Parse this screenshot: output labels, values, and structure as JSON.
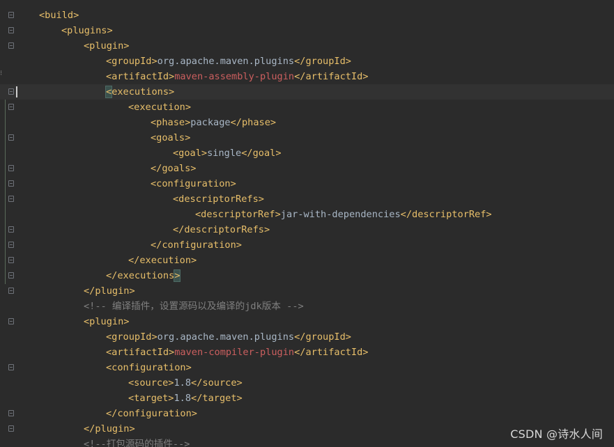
{
  "editor": {
    "lines": [
      {
        "indent": 0,
        "parts": [
          {
            "c": "tag",
            "t": "<build>"
          }
        ]
      },
      {
        "indent": 1,
        "parts": [
          {
            "c": "tag",
            "t": "<plugins>"
          }
        ]
      },
      {
        "indent": 2,
        "parts": [
          {
            "c": "tag",
            "t": "<plugin>"
          }
        ]
      },
      {
        "indent": 3,
        "parts": [
          {
            "c": "tag",
            "t": "<groupId>"
          },
          {
            "c": "val",
            "t": "org.apache.maven.plugins"
          },
          {
            "c": "tag",
            "t": "</groupId>"
          }
        ]
      },
      {
        "indent": 3,
        "parts": [
          {
            "c": "tag",
            "t": "<artifactId>"
          },
          {
            "c": "red",
            "t": "maven-assembly-plugin"
          },
          {
            "c": "tag",
            "t": "</artifactId>"
          }
        ]
      },
      {
        "indent": 3,
        "current": true,
        "parts": [
          {
            "c": "tag hl",
            "t": "<"
          },
          {
            "c": "tag",
            "t": "executions>"
          }
        ]
      },
      {
        "indent": 4,
        "parts": [
          {
            "c": "tag",
            "t": "<execution>"
          }
        ]
      },
      {
        "indent": 5,
        "parts": [
          {
            "c": "tag",
            "t": "<phase>"
          },
          {
            "c": "val",
            "t": "package"
          },
          {
            "c": "tag",
            "t": "</phase>"
          }
        ]
      },
      {
        "indent": 5,
        "parts": [
          {
            "c": "tag",
            "t": "<goals>"
          }
        ]
      },
      {
        "indent": 6,
        "parts": [
          {
            "c": "tag",
            "t": "<goal>"
          },
          {
            "c": "val",
            "t": "single"
          },
          {
            "c": "tag",
            "t": "</goal>"
          }
        ]
      },
      {
        "indent": 5,
        "parts": [
          {
            "c": "tag",
            "t": "</goals>"
          }
        ]
      },
      {
        "indent": 5,
        "parts": [
          {
            "c": "tag",
            "t": "<configuration>"
          }
        ]
      },
      {
        "indent": 6,
        "parts": [
          {
            "c": "tag",
            "t": "<descriptorRefs>"
          }
        ]
      },
      {
        "indent": 7,
        "parts": [
          {
            "c": "tag",
            "t": "<descriptorRef>"
          },
          {
            "c": "val",
            "t": "jar-with-dependencies"
          },
          {
            "c": "tag",
            "t": "</descriptorRef>"
          }
        ]
      },
      {
        "indent": 6,
        "parts": [
          {
            "c": "tag",
            "t": "</descriptorRefs>"
          }
        ]
      },
      {
        "indent": 5,
        "parts": [
          {
            "c": "tag",
            "t": "</configuration>"
          }
        ]
      },
      {
        "indent": 4,
        "parts": [
          {
            "c": "tag",
            "t": "</execution>"
          }
        ]
      },
      {
        "indent": 3,
        "parts": [
          {
            "c": "tag",
            "t": "</executions"
          },
          {
            "c": "tag hl",
            "t": ">"
          }
        ]
      },
      {
        "indent": 2,
        "parts": [
          {
            "c": "tag",
            "t": "</plugin>"
          }
        ]
      },
      {
        "indent": 2,
        "parts": [
          {
            "c": "comment",
            "t": "<!-- 编译插件，设置源码以及编译的jdk版本 -->"
          }
        ]
      },
      {
        "indent": 2,
        "parts": [
          {
            "c": "tag",
            "t": "<plugin>"
          }
        ]
      },
      {
        "indent": 3,
        "parts": [
          {
            "c": "tag",
            "t": "<groupId>"
          },
          {
            "c": "val",
            "t": "org.apache.maven.plugins"
          },
          {
            "c": "tag",
            "t": "</groupId>"
          }
        ]
      },
      {
        "indent": 3,
        "parts": [
          {
            "c": "tag",
            "t": "<artifactId>"
          },
          {
            "c": "red",
            "t": "maven-compiler-plugin"
          },
          {
            "c": "tag",
            "t": "</artifactId>"
          }
        ]
      },
      {
        "indent": 3,
        "parts": [
          {
            "c": "tag",
            "t": "<configuration>"
          }
        ]
      },
      {
        "indent": 4,
        "parts": [
          {
            "c": "tag",
            "t": "<source>"
          },
          {
            "c": "val",
            "t": "1.8"
          },
          {
            "c": "tag",
            "t": "</source>"
          }
        ]
      },
      {
        "indent": 4,
        "parts": [
          {
            "c": "tag",
            "t": "<target>"
          },
          {
            "c": "val",
            "t": "1.8"
          },
          {
            "c": "tag",
            "t": "</target>"
          }
        ]
      },
      {
        "indent": 3,
        "parts": [
          {
            "c": "tag",
            "t": "</configuration>"
          }
        ]
      },
      {
        "indent": 2,
        "parts": [
          {
            "c": "tag",
            "t": "</plugin>"
          }
        ]
      },
      {
        "indent": 2,
        "parts": [
          {
            "c": "comment",
            "t": "<!--打包源码的插件-->"
          }
        ]
      }
    ],
    "fold_markers": [
      0,
      1,
      2,
      5,
      6,
      8,
      10,
      11,
      12,
      14,
      15,
      16,
      17,
      18,
      20,
      23,
      26,
      27
    ],
    "colors": {
      "background": "#2b2b2b",
      "tag": "#e8bf6a",
      "value": "#a9b7c6",
      "artifact": "#cc5f5f",
      "comment": "#808080",
      "current_line": "#323232"
    }
  },
  "watermark": {
    "text": "CSDN @诗水人间"
  },
  "gutter_mark": "⁝"
}
